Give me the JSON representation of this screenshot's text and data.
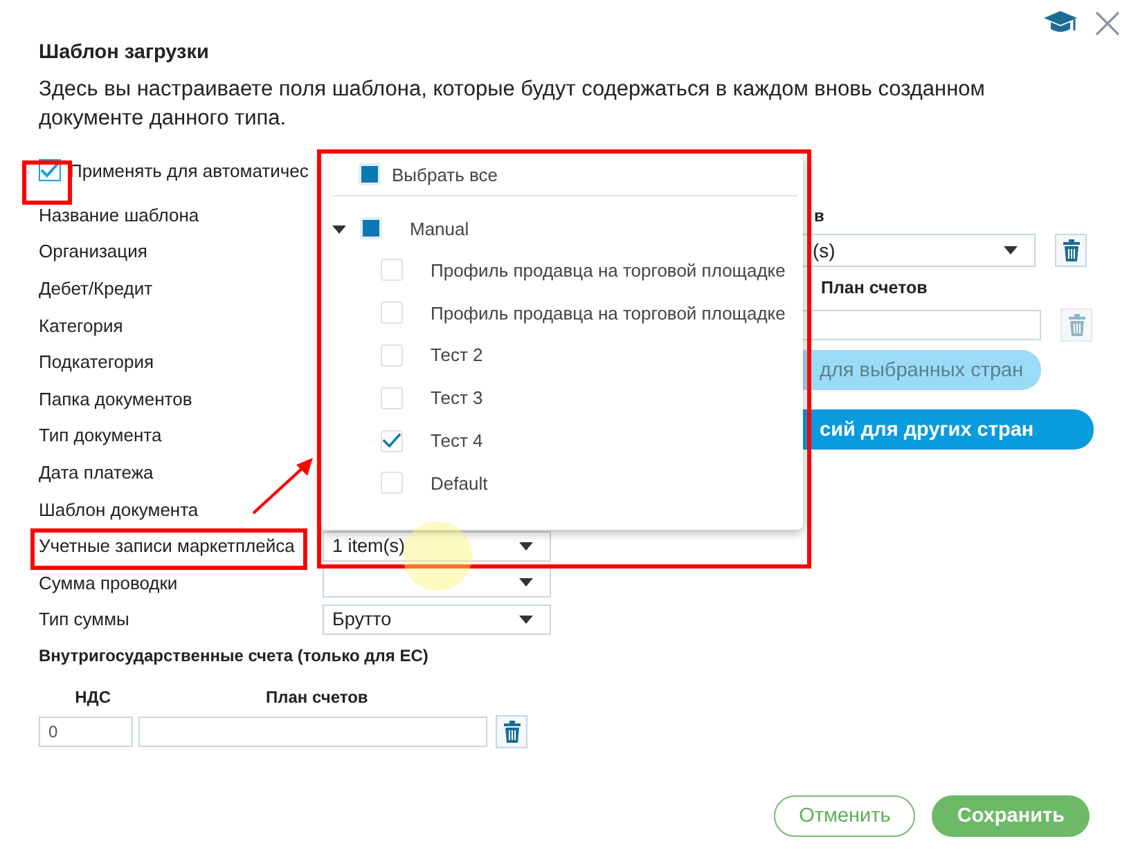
{
  "title": "Шаблон загрузки",
  "description": "Здесь вы настраиваете поля шаблона, которые будут содержаться в каждом вновь созданном документе данного типа.",
  "auto_apply": {
    "label": "Применять для автоматичес",
    "checked": true
  },
  "fields": [
    {
      "label": "Название шаблона",
      "kind": "hidden"
    },
    {
      "label": "Организация",
      "kind": "hidden"
    },
    {
      "label": "Дебет/Кредит",
      "kind": "hidden"
    },
    {
      "label": "Категория",
      "kind": "hidden"
    },
    {
      "label": "Подкатегория",
      "kind": "hidden"
    },
    {
      "label": "Папка документов",
      "kind": "hidden"
    },
    {
      "label": "Тип документа",
      "kind": "hidden"
    },
    {
      "label": "Дата платежа",
      "kind": "hidden"
    },
    {
      "label": "Шаблон документа",
      "kind": "hidden"
    },
    {
      "label": "Учетные записи маркетплейса",
      "kind": "select",
      "value": "1 item(s)"
    },
    {
      "label": "Сумма проводки",
      "kind": "select"
    },
    {
      "label": "Тип суммы",
      "kind": "select",
      "value": "Брутто"
    }
  ],
  "intrastate": {
    "title": "Внутригосударственные счета (только для ЕС)",
    "columns": [
      "НДС",
      "План счетов"
    ],
    "vat_value": "0"
  },
  "right_panel": {
    "header_fragment": "в",
    "select_value": "(s)",
    "plan_label": "План счетов",
    "buttons": [
      {
        "label": "для выбранных стран",
        "disabled": true
      },
      {
        "label": "сий для других стран",
        "disabled": false
      }
    ]
  },
  "dropdown": {
    "select_all": {
      "label": "Выбрать все",
      "partial": true
    },
    "groups": [
      {
        "label": "Manual",
        "expanded": true,
        "partial": true,
        "children": [
          {
            "label": "Профиль продавца на торговой площадке",
            "checked": false
          },
          {
            "label": "Профиль продавца на торговой площадке",
            "checked": false
          },
          {
            "label": "Тест 2",
            "checked": false
          },
          {
            "label": "Тест 3",
            "checked": false
          },
          {
            "label": "Тест 4",
            "checked": true
          },
          {
            "label": "Default",
            "checked": false
          }
        ]
      }
    ]
  },
  "buttons": [
    {
      "label": "Отменить",
      "kind": "secondary"
    },
    {
      "label": "Сохранить",
      "kind": "primary"
    }
  ]
}
